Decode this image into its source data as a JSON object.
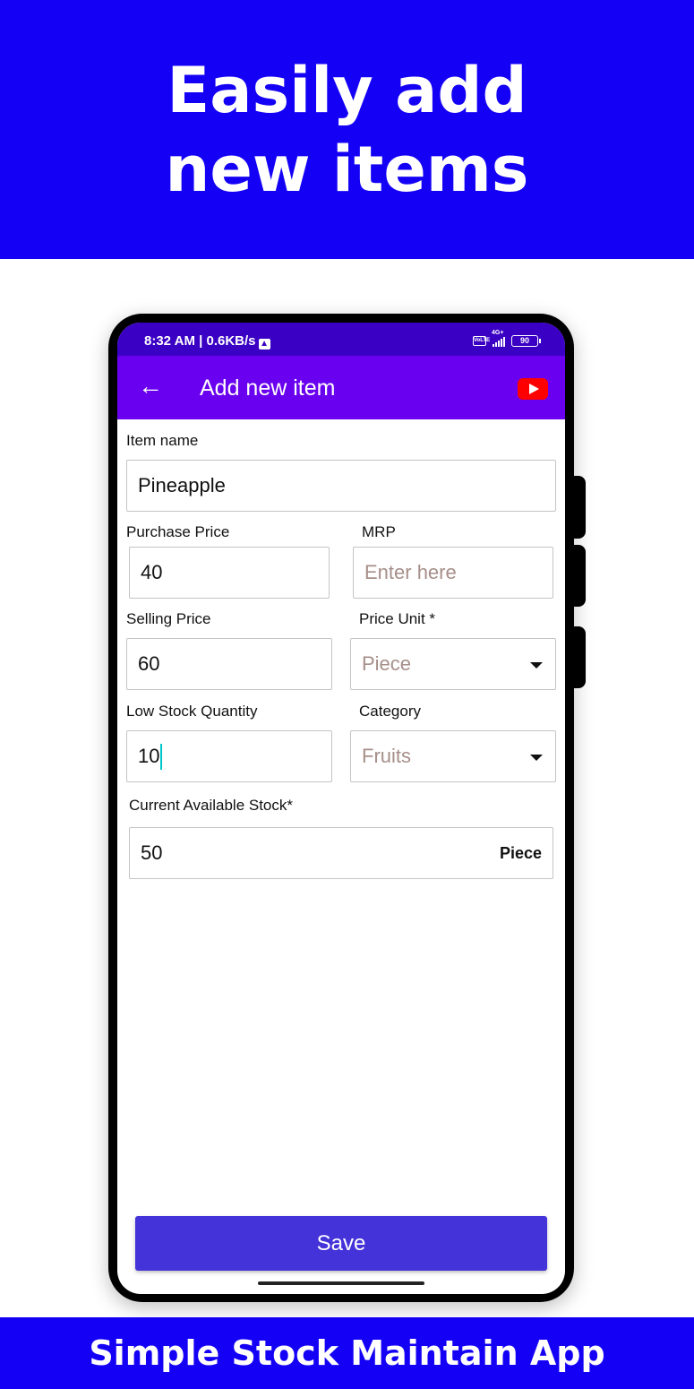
{
  "banner": {
    "title": "Easily add new items"
  },
  "footer": {
    "text": "Simple Stock Maintain App"
  },
  "status_bar": {
    "time": "8:32 AM | 0.6KB/s",
    "upload_icon": "upload-arrow-icon",
    "volte": "VoLTE",
    "network": "4G+",
    "battery": "90"
  },
  "app_bar": {
    "back_icon": "←",
    "title": "Add new item",
    "youtube_icon": "youtube-icon"
  },
  "form": {
    "item_name": {
      "label": "Item name",
      "value": "Pineapple"
    },
    "purchase_price": {
      "label": "Purchase Price",
      "value": "40"
    },
    "mrp": {
      "label": "MRP",
      "placeholder": "Enter here"
    },
    "selling_price": {
      "label": "Selling Price",
      "value": "60"
    },
    "price_unit": {
      "label": "Price Unit *",
      "selected": "Piece"
    },
    "low_stock_quantity": {
      "label": "Low Stock Quantity",
      "value": "10"
    },
    "category": {
      "label": "Category",
      "selected": "Fruits"
    },
    "current_stock": {
      "label": "Current Available Stock*",
      "value": "50",
      "unit": "Piece"
    }
  },
  "actions": {
    "save_label": "Save"
  },
  "colors": {
    "banner_bg": "#1400f5",
    "status_bar": "#3a00c4",
    "app_bar": "#6900ef",
    "save_button": "#4433d9",
    "placeholder_text": "#a68f89"
  }
}
